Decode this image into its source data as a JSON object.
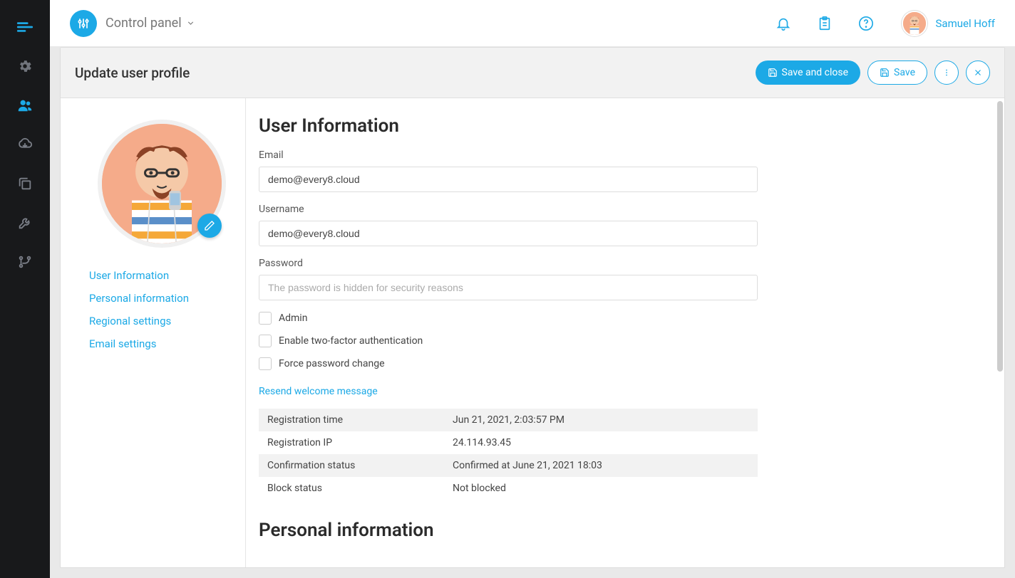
{
  "header": {
    "app_title": "Control panel",
    "user_name": "Samuel Hoff"
  },
  "page": {
    "title": "Update user profile",
    "save_close": "Save and close",
    "save": "Save"
  },
  "side_nav": {
    "items": [
      {
        "label": "User Information"
      },
      {
        "label": "Personal information"
      },
      {
        "label": "Regional settings"
      },
      {
        "label": "Email settings"
      }
    ]
  },
  "user_info": {
    "section_title": "User Information",
    "email_label": "Email",
    "email_value": "demo@every8.cloud",
    "username_label": "Username",
    "username_value": "demo@every8.cloud",
    "password_label": "Password",
    "password_placeholder": "The password is hidden for security reasons",
    "admin_label": "Admin",
    "twofa_label": "Enable two-factor authentication",
    "force_pw_label": "Force password change",
    "resend_link": "Resend welcome message",
    "meta": {
      "reg_time_label": "Registration time",
      "reg_time_value": "Jun 21, 2021, 2:03:57 PM",
      "reg_ip_label": "Registration IP",
      "reg_ip_value": "24.114.93.45",
      "conf_label": "Confirmation status",
      "conf_value": "Confirmed at June 21, 2021 18:03",
      "block_label": "Block status",
      "block_value": "Not blocked"
    }
  },
  "personal": {
    "section_title": "Personal information"
  }
}
